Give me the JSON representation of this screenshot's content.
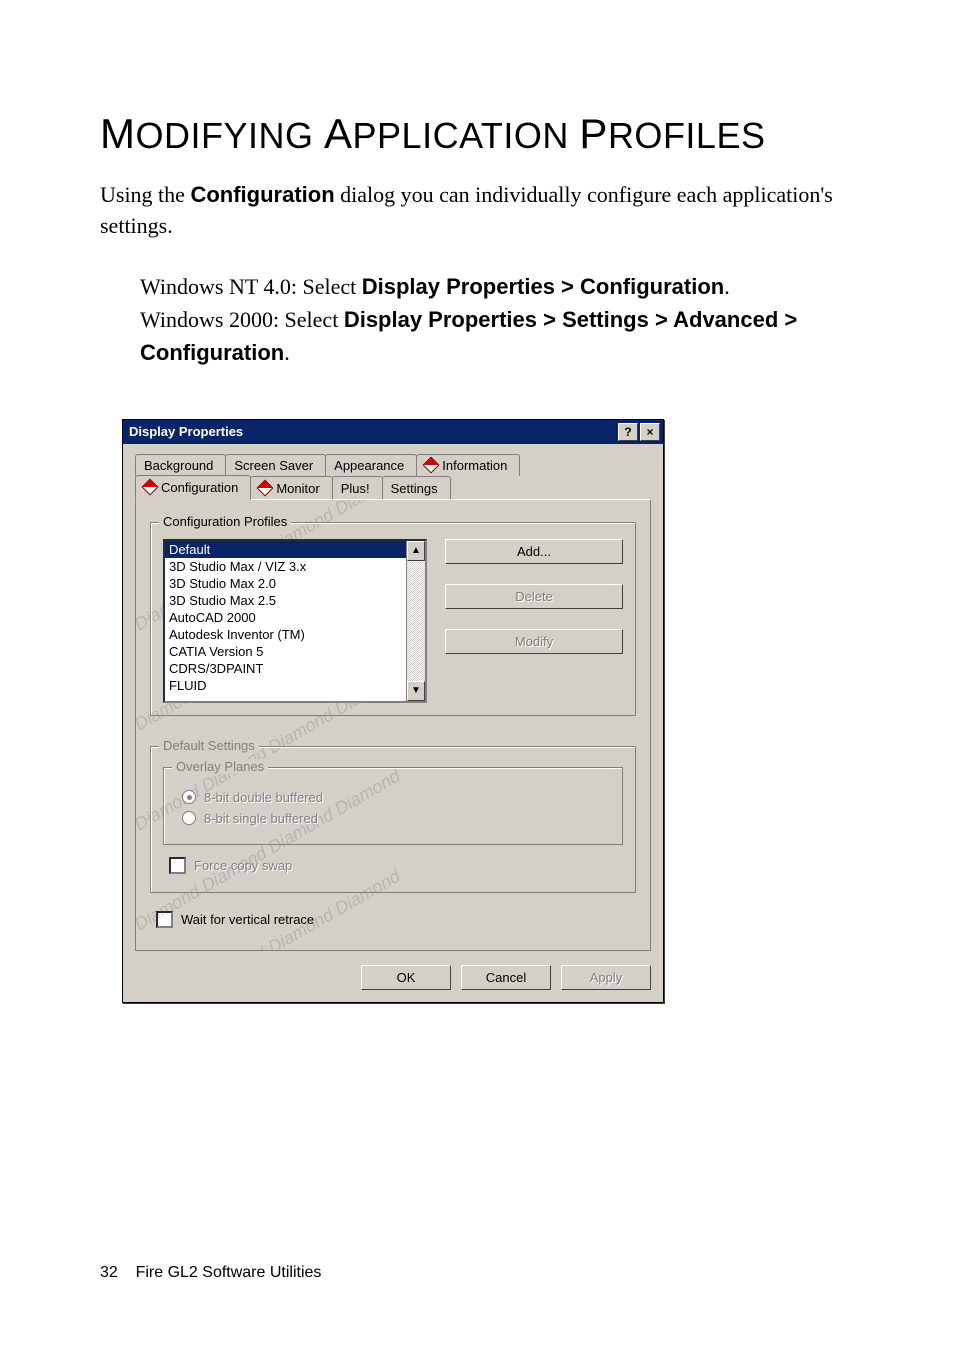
{
  "heading": "MODIFYING APPLICATION PROFILES",
  "intro_prefix": "Using the ",
  "intro_bold": "Configuration",
  "intro_suffix": " dialog you can individually configure each application's settings.",
  "step1_prefix": "Windows NT 4.0: Select ",
  "step1_bold": "Display Properties > Configuration",
  "step1_suffix": ".",
  "step2_prefix": "Windows 2000: Select ",
  "step2_bold": "Display Properties > Settings > Advanced > Configuration",
  "step2_suffix": ".",
  "dialog": {
    "title": "Display Properties",
    "help": "?",
    "close": "×",
    "tabs_row1": [
      "Background",
      "Screen Saver",
      "Appearance",
      "Information"
    ],
    "tabs_row2": [
      "Configuration",
      "Monitor",
      "Plus!",
      "Settings"
    ],
    "active_tab": "Configuration",
    "group_profiles": "Configuration Profiles",
    "profiles": [
      "Default",
      "3D Studio Max / VIZ 3.x",
      "3D Studio Max 2.0",
      "3D Studio Max 2.5",
      "AutoCAD 2000",
      "Autodesk Inventor (TM)",
      "CATIA Version 5",
      "CDRS/3DPAINT",
      "FLUID"
    ],
    "selected_profile": "Default",
    "btn_add": "Add...",
    "btn_delete": "Delete",
    "btn_modify": "Modify",
    "group_default": "Default Settings",
    "group_overlay": "Overlay Planes",
    "radio_double": "8-bit double buffered",
    "radio_single": "8-bit single buffered",
    "check_force": "Force copy swap",
    "check_wait": "Wait for vertical retrace",
    "btn_ok": "OK",
    "btn_cancel": "Cancel",
    "btn_apply": "Apply"
  },
  "footer_page": "32",
  "footer_text": "Fire GL2 Software Utilities"
}
